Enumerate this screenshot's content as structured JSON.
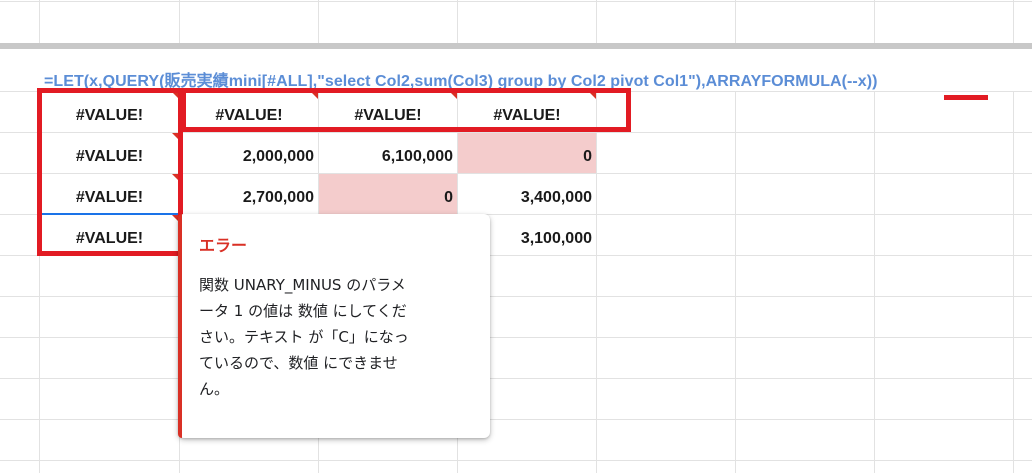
{
  "formula_bar": {
    "formula": "=LET(x,QUERY(販売実績mini[#ALL],\"select Col2,sum(Col3) group by Col2 pivot Col1\"),ARRAYFORMULA(--x))"
  },
  "grid": {
    "rows": [
      {
        "a": "#VALUE!",
        "b": "#VALUE!",
        "c": "#VALUE!",
        "d": "#VALUE!"
      },
      {
        "a": "#VALUE!",
        "b": "2,000,000",
        "c": "6,100,000",
        "d": "0"
      },
      {
        "a": "#VALUE!",
        "b": "2,700,000",
        "c": "0",
        "d": "3,400,000"
      },
      {
        "a": "#VALUE!",
        "b": "",
        "c": "",
        "d": "3,100,000"
      }
    ],
    "highlight_color": "#f4cccc"
  },
  "error_tooltip": {
    "title": "エラー",
    "line1": "関数 UNARY_MINUS のパラメ",
    "line2": "ータ 1 の値は 数値 にしてくだ",
    "line3": "さい。テキスト が「C」になっ",
    "line4": "ているので、数値 にできませ",
    "line5": "ん。",
    "accent_color": "#d93025"
  },
  "annotation_color": "#e21b23"
}
